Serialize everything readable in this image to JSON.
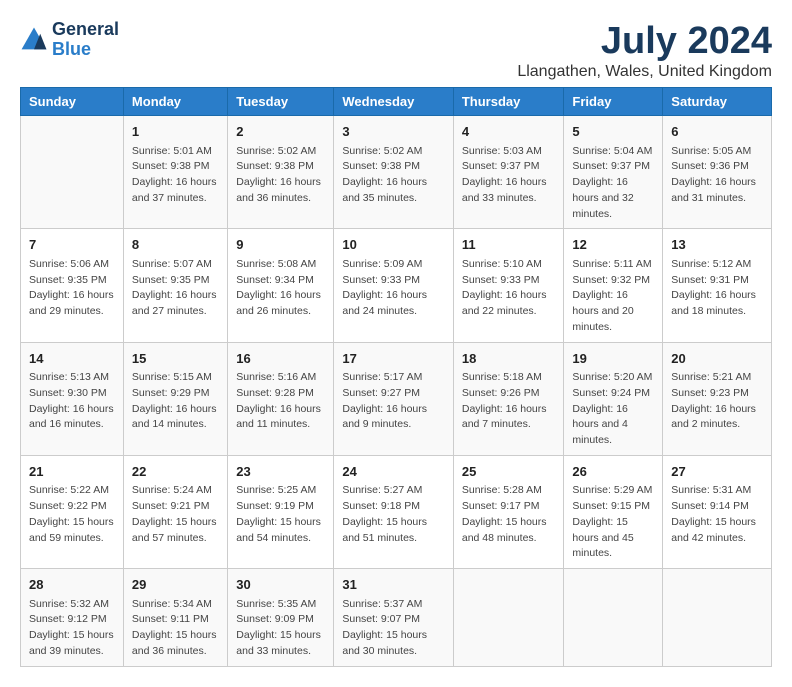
{
  "header": {
    "logo_line1": "General",
    "logo_line2": "Blue",
    "title": "July 2024",
    "subtitle": "Llangathen, Wales, United Kingdom"
  },
  "days": [
    "Sunday",
    "Monday",
    "Tuesday",
    "Wednesday",
    "Thursday",
    "Friday",
    "Saturday"
  ],
  "weeks": [
    [
      {
        "date": "",
        "sunrise": "",
        "sunset": "",
        "daylight": ""
      },
      {
        "date": "1",
        "sunrise": "Sunrise: 5:01 AM",
        "sunset": "Sunset: 9:38 PM",
        "daylight": "Daylight: 16 hours and 37 minutes."
      },
      {
        "date": "2",
        "sunrise": "Sunrise: 5:02 AM",
        "sunset": "Sunset: 9:38 PM",
        "daylight": "Daylight: 16 hours and 36 minutes."
      },
      {
        "date": "3",
        "sunrise": "Sunrise: 5:02 AM",
        "sunset": "Sunset: 9:38 PM",
        "daylight": "Daylight: 16 hours and 35 minutes."
      },
      {
        "date": "4",
        "sunrise": "Sunrise: 5:03 AM",
        "sunset": "Sunset: 9:37 PM",
        "daylight": "Daylight: 16 hours and 33 minutes."
      },
      {
        "date": "5",
        "sunrise": "Sunrise: 5:04 AM",
        "sunset": "Sunset: 9:37 PM",
        "daylight": "Daylight: 16 hours and 32 minutes."
      },
      {
        "date": "6",
        "sunrise": "Sunrise: 5:05 AM",
        "sunset": "Sunset: 9:36 PM",
        "daylight": "Daylight: 16 hours and 31 minutes."
      }
    ],
    [
      {
        "date": "7",
        "sunrise": "Sunrise: 5:06 AM",
        "sunset": "Sunset: 9:35 PM",
        "daylight": "Daylight: 16 hours and 29 minutes."
      },
      {
        "date": "8",
        "sunrise": "Sunrise: 5:07 AM",
        "sunset": "Sunset: 9:35 PM",
        "daylight": "Daylight: 16 hours and 27 minutes."
      },
      {
        "date": "9",
        "sunrise": "Sunrise: 5:08 AM",
        "sunset": "Sunset: 9:34 PM",
        "daylight": "Daylight: 16 hours and 26 minutes."
      },
      {
        "date": "10",
        "sunrise": "Sunrise: 5:09 AM",
        "sunset": "Sunset: 9:33 PM",
        "daylight": "Daylight: 16 hours and 24 minutes."
      },
      {
        "date": "11",
        "sunrise": "Sunrise: 5:10 AM",
        "sunset": "Sunset: 9:33 PM",
        "daylight": "Daylight: 16 hours and 22 minutes."
      },
      {
        "date": "12",
        "sunrise": "Sunrise: 5:11 AM",
        "sunset": "Sunset: 9:32 PM",
        "daylight": "Daylight: 16 hours and 20 minutes."
      },
      {
        "date": "13",
        "sunrise": "Sunrise: 5:12 AM",
        "sunset": "Sunset: 9:31 PM",
        "daylight": "Daylight: 16 hours and 18 minutes."
      }
    ],
    [
      {
        "date": "14",
        "sunrise": "Sunrise: 5:13 AM",
        "sunset": "Sunset: 9:30 PM",
        "daylight": "Daylight: 16 hours and 16 minutes."
      },
      {
        "date": "15",
        "sunrise": "Sunrise: 5:15 AM",
        "sunset": "Sunset: 9:29 PM",
        "daylight": "Daylight: 16 hours and 14 minutes."
      },
      {
        "date": "16",
        "sunrise": "Sunrise: 5:16 AM",
        "sunset": "Sunset: 9:28 PM",
        "daylight": "Daylight: 16 hours and 11 minutes."
      },
      {
        "date": "17",
        "sunrise": "Sunrise: 5:17 AM",
        "sunset": "Sunset: 9:27 PM",
        "daylight": "Daylight: 16 hours and 9 minutes."
      },
      {
        "date": "18",
        "sunrise": "Sunrise: 5:18 AM",
        "sunset": "Sunset: 9:26 PM",
        "daylight": "Daylight: 16 hours and 7 minutes."
      },
      {
        "date": "19",
        "sunrise": "Sunrise: 5:20 AM",
        "sunset": "Sunset: 9:24 PM",
        "daylight": "Daylight: 16 hours and 4 minutes."
      },
      {
        "date": "20",
        "sunrise": "Sunrise: 5:21 AM",
        "sunset": "Sunset: 9:23 PM",
        "daylight": "Daylight: 16 hours and 2 minutes."
      }
    ],
    [
      {
        "date": "21",
        "sunrise": "Sunrise: 5:22 AM",
        "sunset": "Sunset: 9:22 PM",
        "daylight": "Daylight: 15 hours and 59 minutes."
      },
      {
        "date": "22",
        "sunrise": "Sunrise: 5:24 AM",
        "sunset": "Sunset: 9:21 PM",
        "daylight": "Daylight: 15 hours and 57 minutes."
      },
      {
        "date": "23",
        "sunrise": "Sunrise: 5:25 AM",
        "sunset": "Sunset: 9:19 PM",
        "daylight": "Daylight: 15 hours and 54 minutes."
      },
      {
        "date": "24",
        "sunrise": "Sunrise: 5:27 AM",
        "sunset": "Sunset: 9:18 PM",
        "daylight": "Daylight: 15 hours and 51 minutes."
      },
      {
        "date": "25",
        "sunrise": "Sunrise: 5:28 AM",
        "sunset": "Sunset: 9:17 PM",
        "daylight": "Daylight: 15 hours and 48 minutes."
      },
      {
        "date": "26",
        "sunrise": "Sunrise: 5:29 AM",
        "sunset": "Sunset: 9:15 PM",
        "daylight": "Daylight: 15 hours and 45 minutes."
      },
      {
        "date": "27",
        "sunrise": "Sunrise: 5:31 AM",
        "sunset": "Sunset: 9:14 PM",
        "daylight": "Daylight: 15 hours and 42 minutes."
      }
    ],
    [
      {
        "date": "28",
        "sunrise": "Sunrise: 5:32 AM",
        "sunset": "Sunset: 9:12 PM",
        "daylight": "Daylight: 15 hours and 39 minutes."
      },
      {
        "date": "29",
        "sunrise": "Sunrise: 5:34 AM",
        "sunset": "Sunset: 9:11 PM",
        "daylight": "Daylight: 15 hours and 36 minutes."
      },
      {
        "date": "30",
        "sunrise": "Sunrise: 5:35 AM",
        "sunset": "Sunset: 9:09 PM",
        "daylight": "Daylight: 15 hours and 33 minutes."
      },
      {
        "date": "31",
        "sunrise": "Sunrise: 5:37 AM",
        "sunset": "Sunset: 9:07 PM",
        "daylight": "Daylight: 15 hours and 30 minutes."
      },
      {
        "date": "",
        "sunrise": "",
        "sunset": "",
        "daylight": ""
      },
      {
        "date": "",
        "sunrise": "",
        "sunset": "",
        "daylight": ""
      },
      {
        "date": "",
        "sunrise": "",
        "sunset": "",
        "daylight": ""
      }
    ]
  ]
}
